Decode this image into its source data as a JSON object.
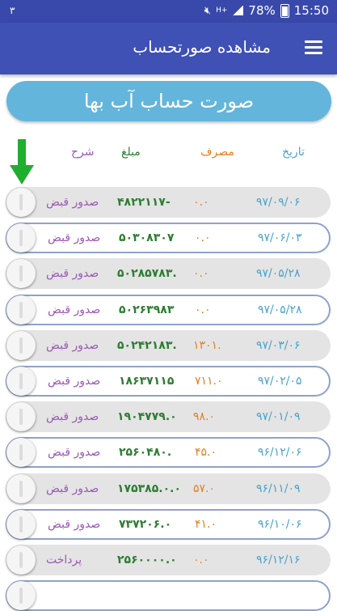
{
  "status_bar": {
    "left_indicator": "۳",
    "network": "H+",
    "battery": "78%",
    "time": "15:50",
    "icons": [
      "mute-icon",
      "network-icon",
      "signal-icon",
      "battery-icon"
    ]
  },
  "app_bar": {
    "title": "مشاهده صورتحساب",
    "menu_icon": "hamburger-menu-icon"
  },
  "banner": {
    "label": "صورت حساب آب بها"
  },
  "table": {
    "headers": {
      "date": "تاریخ",
      "usage": "مصرف",
      "amount": "مبلغ",
      "description": "شرح"
    },
    "rows": [
      {
        "date": "۹۷/۰۹/۰۶",
        "usage": "۰.۰",
        "amount": "۴۸۲۲۱۱۷-",
        "description": "صدور قبض",
        "style": "gray"
      },
      {
        "date": "۹۷/۰۶/۰۳",
        "usage": "۰.۰",
        "amount": "۵۰۳۰۸۳۰۷",
        "description": "صدور قبض",
        "style": "white"
      },
      {
        "date": "۹۷/۰۵/۲۸",
        "usage": "۰.۰",
        "amount": "۵۰۲۸۵۷۸۳.",
        "description": "صدور قبض",
        "style": "gray"
      },
      {
        "date": "۹۷/۰۵/۲۸",
        "usage": "۰.۰",
        "amount": "۵۰۲۶۳۹۸۳",
        "description": "صدور قبض",
        "style": "white"
      },
      {
        "date": "۹۷/۰۳/۰۶",
        "usage": "۱۳۰۱.",
        "amount": "۵۰۲۴۲۱۸۳.",
        "description": "صدور قبض",
        "style": "gray"
      },
      {
        "date": "۹۷/۰۲/۰۵",
        "usage": "۷۱۱.۰",
        "amount": "۱۸۶۳۷۱۱۵",
        "description": "صدور قبض",
        "style": "white"
      },
      {
        "date": "۹۷/۰۱/۰۹",
        "usage": "۹۸.۰",
        "amount": "۱۹۰۴۷۷۹.۰",
        "description": "صدور قبض",
        "style": "gray"
      },
      {
        "date": "۹۶/۱۲/۰۶",
        "usage": "۴۵.۰",
        "amount": "۲۵۶۰۴۸۰.",
        "description": "صدور قبض",
        "style": "white"
      },
      {
        "date": "۹۶/۱۱/۰۹",
        "usage": "۵۷.۰",
        "amount": "۱۷۵۳۸۵.۰.۰",
        "description": "صدور قبض",
        "style": "gray"
      },
      {
        "date": "۹۶/۱۰/۰۶",
        "usage": "۴۱.۰",
        "amount": "۷۳۷۲۰۶.۰",
        "description": "صدور قبض",
        "style": "white"
      },
      {
        "date": "۹۶/۱۲/۱۶",
        "usage": "۰.۰",
        "amount": "۲۵۶۰۰۰۰.۰",
        "description": "پرداخت",
        "style": "gray"
      },
      {
        "date": "",
        "usage": "",
        "amount": "",
        "description": "",
        "style": "white"
      }
    ]
  },
  "colors": {
    "status_bar": "#3949ab",
    "app_bar": "#3f51b5",
    "banner": "#64b5db",
    "date": "#4aa3c9",
    "usage": "#e67e22",
    "amount": "#2e7d32",
    "description": "#9b59b6",
    "arrow": "#1fae2e"
  }
}
